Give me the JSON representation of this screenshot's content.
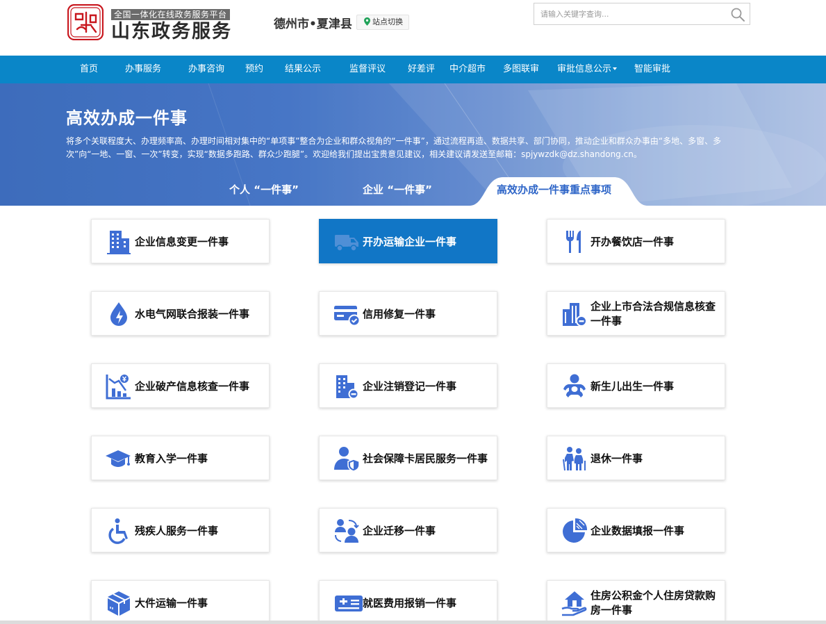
{
  "header": {
    "logo_seal_text": "中国山东",
    "platform_tag": "全国一体化在线政务服务平台",
    "brand_name": "山东政务服务",
    "region": "德州市•夏津县",
    "site_switch_label": "站点切换",
    "search_placeholder": "请输入关键字查询..."
  },
  "nav": {
    "items": [
      {
        "label": "首页"
      },
      {
        "label": "办事服务"
      },
      {
        "label": "办事咨询"
      },
      {
        "label": "预约"
      },
      {
        "label": "结果公示"
      },
      {
        "label": "监督评议"
      },
      {
        "label": "好差评"
      },
      {
        "label": "中介超市"
      },
      {
        "label": "多图联审"
      },
      {
        "label": "审批信息公示",
        "has_dropdown": true
      },
      {
        "label": "智能审批"
      }
    ]
  },
  "banner": {
    "title": "高效办成一件事",
    "description": "将多个关联程度大、办理频率高、办理时间相对集中的“单项事”整合为企业和群众视角的“一件事”，通过流程再造、数据共享、部门协同，推动企业和群众办事由“多地、多窗、多次”向“一地、一窗、一次”转变，实现“数据多跑路、群众少跑腿”。欢迎给我们提出宝贵意见建议，相关建议请发送至邮箱：spjywzdk@dz.shandong.cn。"
  },
  "tabs": [
    {
      "label": "个人 “一件事”",
      "active": false
    },
    {
      "label": "企业 “一件事”",
      "active": false
    },
    {
      "label": "高效办成一件事重点事项",
      "active": true
    }
  ],
  "colors": {
    "nav_bg": "#0a86c8",
    "icon_blue": "#3f6ed4",
    "highlight_card": "#1176c6",
    "active_tab_text": "#2f66c8"
  },
  "cards": [
    {
      "label": "企业信息变更一件事",
      "icon": "building-icon"
    },
    {
      "label": "开办运输企业一件事",
      "icon": "truck-icon",
      "highlighted": true
    },
    {
      "label": "开办餐饮店一件事",
      "icon": "fork-knife-icon"
    },
    {
      "label": "水电气网联合报装一件事",
      "icon": "water-drop-icon"
    },
    {
      "label": "信用修复一件事",
      "icon": "credit-card-check-icon"
    },
    {
      "label": "企业上市合法合规信息核查一件事",
      "icon": "building-search-icon"
    },
    {
      "label": "企业破产信息核查一件事",
      "icon": "bankruptcy-chart-icon"
    },
    {
      "label": "企业注销登记一件事",
      "icon": "building-minus-icon"
    },
    {
      "label": "新生儿出生一件事",
      "icon": "baby-icon"
    },
    {
      "label": "教育入学一件事",
      "icon": "graduation-cap-icon"
    },
    {
      "label": "社会保障卡居民服务一件事",
      "icon": "user-shield-icon"
    },
    {
      "label": "退休一件事",
      "icon": "elderly-couple-icon"
    },
    {
      "label": "残疾人服务一件事",
      "icon": "wheelchair-icon"
    },
    {
      "label": "企业迁移一件事",
      "icon": "user-transfer-icon"
    },
    {
      "label": "企业数据填报一件事",
      "icon": "pie-chart-icon"
    },
    {
      "label": "大件运输一件事",
      "icon": "package-icon"
    },
    {
      "label": "就医费用报销一件事",
      "icon": "medical-card-icon"
    },
    {
      "label": "住房公积金个人住房贷款购房一件事",
      "icon": "house-hand-icon"
    }
  ]
}
